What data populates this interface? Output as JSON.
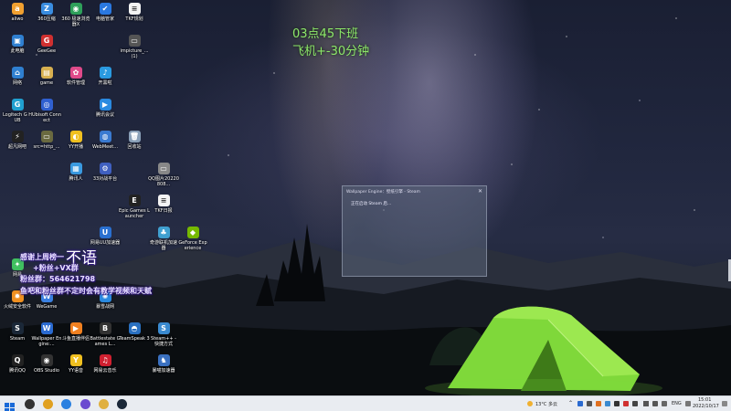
{
  "desktop_icons": [
    {
      "label": "aliwo",
      "glyph": "a",
      "color": "#f0a030",
      "icon": "app-icon"
    },
    {
      "label": "360压缩",
      "glyph": "Z",
      "color": "#3a8de0",
      "icon": "archive-icon"
    },
    {
      "label": "360 极速浏览器X",
      "glyph": "◉",
      "color": "#2ea05a",
      "icon": "browser-icon"
    },
    {
      "label": "电脑管家",
      "glyph": "✔",
      "color": "#2a78e0",
      "icon": "shield-icon"
    },
    {
      "label": "TKF规划",
      "glyph": "≡",
      "color": "#f4f4f4",
      "icon": "document-icon"
    },
    {
      "label": "此电脑",
      "glyph": "▣",
      "color": "#2f7fd0",
      "icon": "computer-icon"
    },
    {
      "label": "GeeGee",
      "glyph": "G",
      "color": "#d03030",
      "icon": "game-icon"
    },
    {
      "label": "impicture_...(1)",
      "glyph": "▭",
      "color": "#555",
      "icon": "image-icon"
    },
    {
      "label": "网络",
      "glyph": "⌂",
      "color": "#2f7fd0",
      "icon": "network-icon"
    },
    {
      "label": "game",
      "glyph": "▤",
      "color": "#d8b050",
      "icon": "folder-icon"
    },
    {
      "label": "软件管理",
      "glyph": "✿",
      "color": "#e04a8a",
      "icon": "software-icon"
    },
    {
      "label": "开黑啦",
      "glyph": "♪",
      "color": "#2a9ae0",
      "icon": "voice-icon"
    },
    {
      "label": "Logitech G HUB",
      "glyph": "G",
      "color": "#20a0d0",
      "icon": "logitech-icon"
    },
    {
      "label": "Ubisoft Connect",
      "glyph": "◎",
      "color": "#3060d0",
      "icon": "ubisoft-icon"
    },
    {
      "label": "腾讯会议",
      "glyph": "▶",
      "color": "#2a8ae0",
      "icon": "meeting-icon"
    },
    {
      "label": "超凡网吧",
      "glyph": "⚡",
      "color": "#222",
      "icon": "cafe-icon"
    },
    {
      "label": "src=http_...",
      "glyph": "▭",
      "color": "#6a6a40",
      "icon": "image-icon"
    },
    {
      "label": "YY开播",
      "glyph": "◐",
      "color": "#f0c020",
      "icon": "yy-icon"
    },
    {
      "label": "WebMeet...",
      "glyph": "◍",
      "color": "#3a7ad0",
      "icon": "webmeet-icon"
    },
    {
      "label": "回收站",
      "glyph": "🗑",
      "color": "#8aa0b8",
      "icon": "recycle-bin-icon"
    },
    {
      "label": "腾讯人",
      "glyph": "▦",
      "color": "#3a9ae0",
      "icon": "app-icon"
    },
    {
      "label": "33对战平台",
      "glyph": "⚙",
      "color": "#4060c0",
      "icon": "platform-icon"
    },
    {
      "label": "QQ图片20220808...",
      "glyph": "▭",
      "color": "#888",
      "icon": "image-icon"
    },
    {
      "label": "Epic Games Launcher",
      "glyph": "E",
      "color": "#222",
      "icon": "epic-icon"
    },
    {
      "label": "TKF日报",
      "glyph": "≡",
      "color": "#f4f4f4",
      "icon": "document-icon"
    },
    {
      "label": "网易UU加速器",
      "glyph": "U",
      "color": "#2a70d0",
      "icon": "uu-icon"
    },
    {
      "label": "奇游联机加速器",
      "glyph": "♣",
      "color": "#40a0d0",
      "icon": "accelerator-icon"
    },
    {
      "label": "GeForce Experience",
      "glyph": "◆",
      "color": "#76b900",
      "icon": "nvidia-icon"
    },
    {
      "label": "网易",
      "glyph": "✦",
      "color": "#40c060",
      "icon": "app-icon"
    },
    {
      "label": "火绒安全软件",
      "glyph": "✹",
      "color": "#f09020",
      "icon": "huorong-icon"
    },
    {
      "label": "WeGame",
      "glyph": "W",
      "color": "#3a80e0",
      "icon": "wegame-icon"
    },
    {
      "label": "暴雪战网",
      "glyph": "✺",
      "color": "#2a8ae0",
      "icon": "battlenet-icon"
    },
    {
      "label": "Steam",
      "glyph": "S",
      "color": "#1b2838",
      "icon": "steam-icon"
    },
    {
      "label": "Wallpaper Engine:...",
      "glyph": "W",
      "color": "#2a6ad0",
      "icon": "wallpaper-engine-icon"
    },
    {
      "label": "斗鱼直播伴侣",
      "glyph": "▶",
      "color": "#f08020",
      "icon": "douyu-icon"
    },
    {
      "label": "Battlestate Games L...",
      "glyph": "B",
      "color": "#333",
      "icon": "battlestate-icon"
    },
    {
      "label": "TeamSpeak 3",
      "glyph": "◓",
      "color": "#2a70c0",
      "icon": "teamspeak-icon"
    },
    {
      "label": "Steam++ - 快捷方式",
      "glyph": "S",
      "color": "#3a8ad0",
      "icon": "steampp-icon"
    },
    {
      "label": "腾讯QQ",
      "glyph": "Q",
      "color": "#222",
      "icon": "qq-icon"
    },
    {
      "label": "OBS Studio",
      "glyph": "◉",
      "color": "#333",
      "icon": "obs-icon"
    },
    {
      "label": "YY语音",
      "glyph": "Y",
      "color": "#f0c020",
      "icon": "yy-voice-icon"
    },
    {
      "label": "网易云音乐",
      "glyph": "♫",
      "color": "#d02030",
      "icon": "music-icon"
    },
    {
      "label": "暴喵加速器",
      "glyph": "♞",
      "color": "#3a70c0",
      "icon": "accelerator-icon"
    }
  ],
  "notice": {
    "line1": "03点45下班",
    "line2": "飞机+-30分钟"
  },
  "overlay": {
    "thanks": "感谢上周榜一",
    "name": "不语",
    "group": "+粉丝+VX群",
    "fan_group": "粉丝群：564621798",
    "promo": "鱼吧和粉丝群不定时会有教学视频和天赋"
  },
  "wallpaper_window": {
    "title": "Wallpaper Engine：壁纸引擎 - Steam",
    "message": "正在启动 Steam 后..."
  },
  "taskbar": {
    "apps": [
      {
        "name": "start",
        "color": "#2a6ad0",
        "icon": "windows-start-icon"
      },
      {
        "name": "obs",
        "color": "#333",
        "icon": "obs-icon"
      },
      {
        "name": "chrome",
        "color": "#e0a020",
        "icon": "chrome-icon"
      },
      {
        "name": "browser",
        "color": "#2a80e0",
        "icon": "browser-icon"
      },
      {
        "name": "app",
        "color": "#6a4ad0",
        "icon": "app-icon"
      },
      {
        "name": "explorer",
        "color": "#e0b040",
        "icon": "folder-icon"
      },
      {
        "name": "steam",
        "color": "#1b2838",
        "icon": "steam-icon"
      }
    ],
    "weather": "13°C 多云",
    "lang": "ENG",
    "time": "15:01",
    "date": "2022/10/17"
  }
}
